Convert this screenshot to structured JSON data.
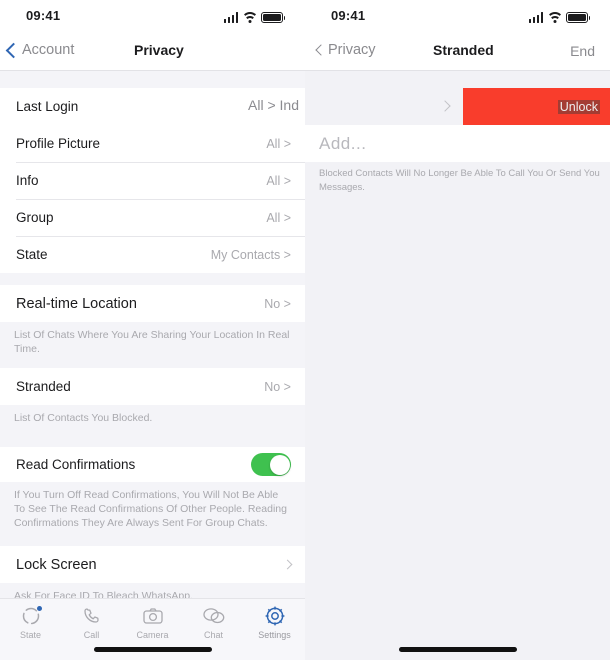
{
  "left_panel": {
    "status": {
      "time": "09:41",
      "signal_icon": "cellular-signal-icon",
      "wifi_icon": "wifi-icon",
      "battery_icon": "battery-icon"
    },
    "nav": {
      "back_label": "Account",
      "title": "Privacy"
    },
    "group1": [
      {
        "label": "Last Login",
        "value": "All > Ind"
      },
      {
        "label": "Profile Picture",
        "value": "All >"
      },
      {
        "label": "Info",
        "value": "All >"
      },
      {
        "label": "Group",
        "value": "All >"
      },
      {
        "label": "State",
        "value": "My Contacts >"
      }
    ],
    "group2": {
      "label": "Real-time Location",
      "value": "No >",
      "footnote": "List Of Chats Where You Are Sharing Your Location In Real Time."
    },
    "group3": {
      "label": "Stranded",
      "value": "No >",
      "footnote": "List Of Contacts You Blocked."
    },
    "group4": {
      "label": "Read Confirmations",
      "toggle_on": true,
      "footnote": "If You Turn Off Read Confirmations, You Will Not Be Able To See The Read Confirmations Of Other People. Reading Confirmations They Are Always Sent For Group Chats."
    },
    "group5": {
      "label": "Lock Screen",
      "footnote": "Ask For Face ID To Bleach WhatsApp."
    },
    "tabs": [
      {
        "label": "State",
        "icon": "status-ring-icon",
        "active": false,
        "badge": true
      },
      {
        "label": "Call",
        "icon": "phone-icon",
        "active": false,
        "badge": false
      },
      {
        "label": "Camera",
        "icon": "camera-icon",
        "active": false,
        "badge": false
      },
      {
        "label": "Chat",
        "icon": "chat-bubble-icon",
        "active": false,
        "badge": false
      },
      {
        "label": "Settings",
        "icon": "gear-icon",
        "active": true,
        "badge": false
      }
    ]
  },
  "right_panel": {
    "status": {
      "time": "09:41"
    },
    "nav": {
      "back_label": "Privacy",
      "title": "Stranded",
      "action_label": "End"
    },
    "unlock_button_label": "Unlock",
    "add_placeholder": "Add...",
    "footnote": "Blocked Contacts Will No Longer Be Able To Call You Or Send You Messages."
  },
  "colors": {
    "accent_blue": "#2f66b3",
    "danger_red": "#f93d2c",
    "toggle_green": "#3fc14f",
    "muted_gray": "#a9a9ae"
  }
}
